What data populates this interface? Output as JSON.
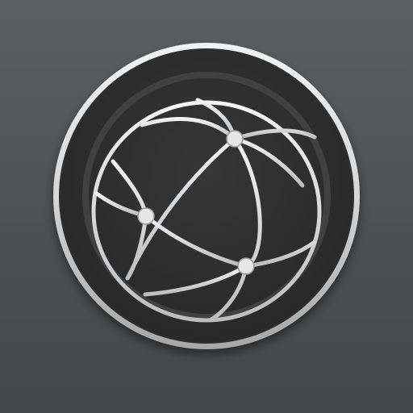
{
  "icon": {
    "name": "globe-network-icon",
    "colors": {
      "background_top": "#5a6064",
      "background_bottom": "#43484c",
      "ring_light": "#e9e9e9",
      "ring_dark": "#9c9c9c",
      "disc_outer": "#3a3e40",
      "disc_inner": "#2b2e30",
      "globe_lines": "#dcdcdc",
      "nodes": "#e6e6e6"
    }
  }
}
